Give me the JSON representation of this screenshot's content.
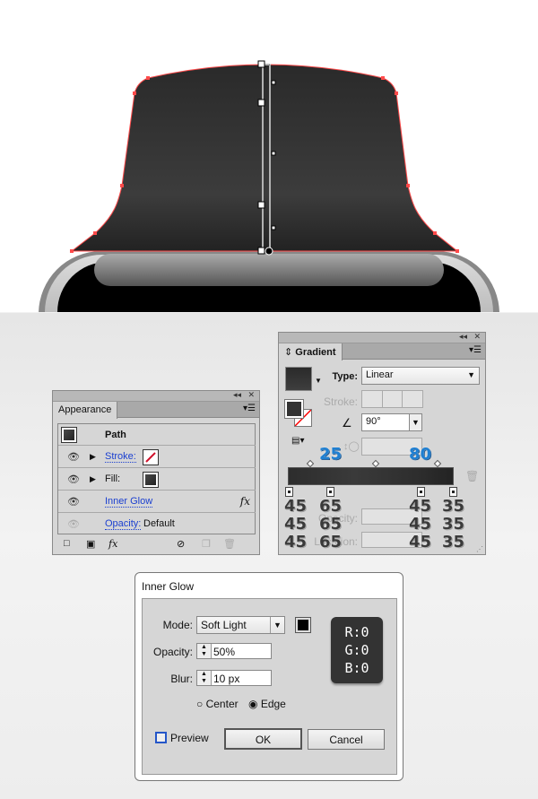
{
  "appearance": {
    "tab": "Appearance",
    "title": "Path",
    "stroke_label": "Stroke:",
    "fill_label": "Fill:",
    "effect_label": "Inner Glow",
    "fx": "fx",
    "opacity_label": "Opacity:",
    "opacity_value": "Default",
    "footer_fx": "fx"
  },
  "gradient": {
    "tab": "Gradient",
    "type_label": "Type:",
    "type_value": "Linear",
    "stroke_label": "Stroke:",
    "angle_value": "90°",
    "opacity_label": "Opacity:",
    "location_label": "Location:"
  },
  "annotations": {
    "midpoints": [
      "25",
      "80"
    ],
    "stop_rows": [
      [
        "45",
        "65",
        "45",
        "35"
      ],
      [
        "45",
        "65",
        "45",
        "35"
      ],
      [
        "45",
        "65",
        "45",
        "35"
      ]
    ]
  },
  "inner_glow": {
    "title": "Inner Glow",
    "mode_label": "Mode:",
    "mode_value": "Soft Light",
    "opacity_label": "Opacity:",
    "opacity_value": "50%",
    "blur_label": "Blur:",
    "blur_value": "10 px",
    "center_label": "Center",
    "edge_label": "Edge",
    "selected": "Edge",
    "preview_label": "Preview",
    "preview_checked": false,
    "ok": "OK",
    "cancel": "Cancel",
    "color": "#000000",
    "rgb": [
      "R:0",
      "G:0",
      "B:0"
    ]
  },
  "colors": {
    "stroke": "#ff4a4a",
    "shape": "#333333"
  }
}
